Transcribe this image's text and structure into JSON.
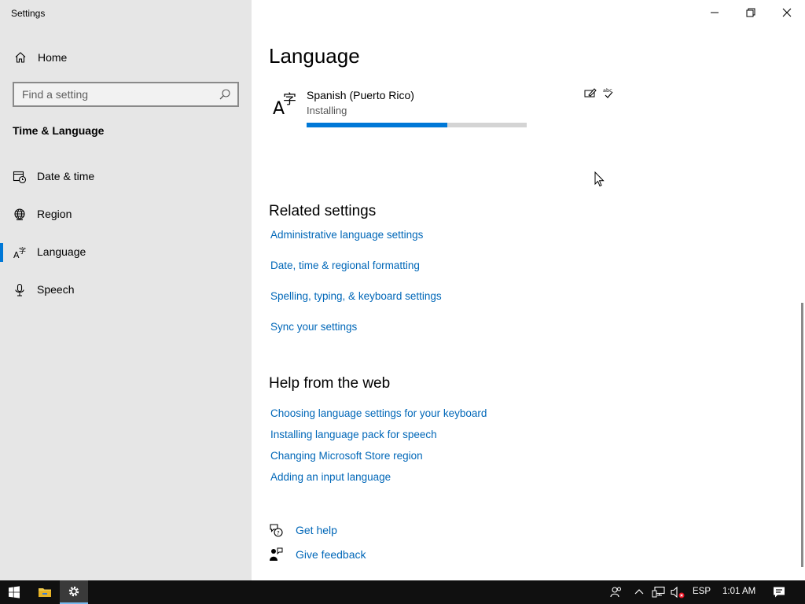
{
  "window": {
    "title": "Settings"
  },
  "sidebar": {
    "home_label": "Home",
    "search_placeholder": "Find a setting",
    "section_title": "Time & Language",
    "items": [
      {
        "label": "Date & time",
        "icon": "calendar-clock-icon",
        "selected": false
      },
      {
        "label": "Region",
        "icon": "globe-icon",
        "selected": false
      },
      {
        "label": "Language",
        "icon": "language-icon",
        "selected": true
      },
      {
        "label": "Speech",
        "icon": "microphone-icon",
        "selected": false
      }
    ]
  },
  "main": {
    "title": "Language",
    "language_entry": {
      "name": "Spanish (Puerto Rico)",
      "status": "Installing",
      "progress": 0.64,
      "feature_icons": [
        "handwriting-icon",
        "spellcheck-icon"
      ]
    },
    "related": {
      "title": "Related settings",
      "links": [
        "Administrative language settings",
        "Date, time & regional formatting",
        "Spelling, typing, & keyboard settings",
        "Sync your settings"
      ]
    },
    "help_web": {
      "title": "Help from the web",
      "links": [
        "Choosing language settings for your keyboard",
        "Installing language pack for speech",
        "Changing Microsoft Store region",
        "Adding an input language"
      ]
    },
    "get_help": "Get help",
    "give_feedback": "Give feedback"
  },
  "taskbar": {
    "input_language": "ESP",
    "time": "1:01 AM"
  },
  "colors": {
    "accent": "#0078d7",
    "link": "#0067b8",
    "sidebar_bg": "#e6e6e6",
    "taskbar_bg": "#101010"
  }
}
